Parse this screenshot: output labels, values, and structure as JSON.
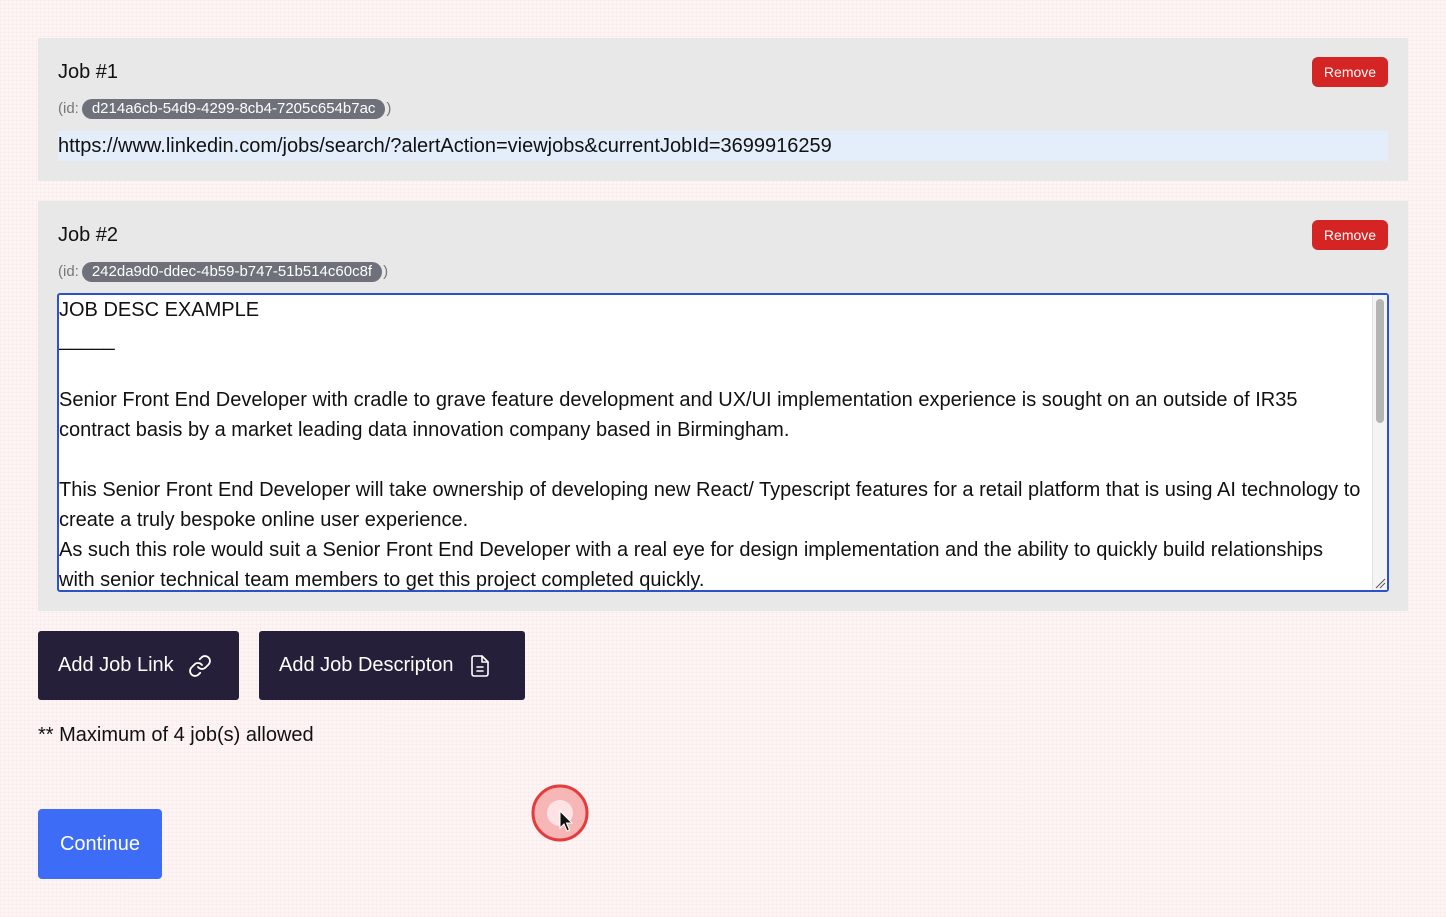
{
  "jobs": [
    {
      "title": "Job #1",
      "remove_label": "Remove",
      "id_prefix": "(id:",
      "id": "d214a6cb-54d9-4299-8cb4-7205c654b7ac",
      "id_suffix": ")",
      "link_value": "https://www.linkedin.com/jobs/search/?alertAction=viewjobs&currentJobId=3699916259"
    },
    {
      "title": "Job #2",
      "remove_label": "Remove",
      "id_prefix": "(id:",
      "id": "242da9d0-ddec-4b59-b747-51b514c60c8f",
      "id_suffix": ")",
      "description_value": "JOB DESC EXAMPLE\n_____\n\nSenior Front End Developer with cradle to grave feature development and UX/UI implementation experience is sought on an outside of IR35 contract basis by a market leading data innovation company based in Birmingham.\n\nThis Senior Front End Developer will take ownership of developing new React/ Typescript features for a retail platform that is using AI technology to create a truly bespoke online user experience.\nAs such this role would suit a Senior Front End Developer with a real eye for design implementation and the ability to quickly build relationships with senior technical team members to get this project completed quickly."
    }
  ],
  "actions": {
    "add_link_label": "Add Job Link",
    "add_link_icon": "link-icon",
    "add_description_label": "Add Job Descripton",
    "add_description_icon": "document-icon"
  },
  "note": "** Maximum of 4 job(s) allowed",
  "continue_label": "Continue",
  "colors": {
    "background": "#fdf4f4",
    "card": "#e8e8e8",
    "remove_button": "#d42424",
    "dark_button": "#251f39",
    "continue_button": "#3d6cf6",
    "focus_border": "#2a53c7",
    "link_field": "#e4eefb"
  }
}
